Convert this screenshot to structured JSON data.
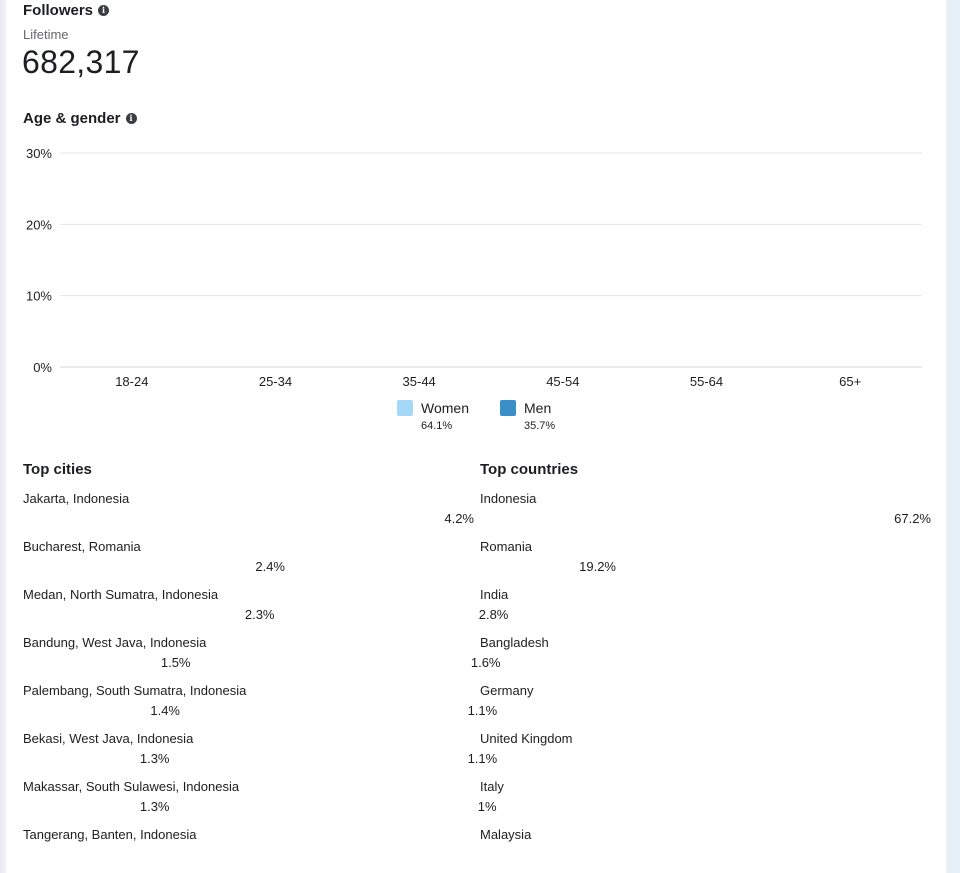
{
  "followers": {
    "title": "Followers",
    "period": "Lifetime",
    "total": "682,317",
    "title_icon": "info-icon"
  },
  "age_gender": {
    "title": "Age & gender",
    "title_icon": "info-icon"
  },
  "chart_data": {
    "type": "bar",
    "title": "",
    "categories": [
      "18-24",
      "25-34",
      "35-44",
      "45-54",
      "55-64",
      "65+"
    ],
    "series": [
      {
        "name": "Women",
        "values": [
          0,
          0,
          0,
          0,
          0,
          0
        ]
      },
      {
        "name": "Men",
        "values": [
          0,
          0,
          0,
          0,
          0,
          0
        ]
      }
    ],
    "y_ticks": [
      "0%",
      "10%",
      "20%",
      "30%"
    ],
    "ylim": [
      0,
      30
    ],
    "grid": true,
    "legend_position": "bottom"
  },
  "legend": [
    {
      "label": "Women",
      "value": "64.1%",
      "color": "#a5d8f6"
    },
    {
      "label": "Men",
      "value": "35.7%",
      "color": "#3b8fc9"
    }
  ],
  "top_cities": {
    "title": "Top cities",
    "items": [
      {
        "name": "Jakarta, Indonesia",
        "value": "4.2%",
        "share": 4.2
      },
      {
        "name": "Bucharest, Romania",
        "value": "2.4%",
        "share": 2.4
      },
      {
        "name": "Medan, North Sumatra, Indonesia",
        "value": "2.3%",
        "share": 2.3
      },
      {
        "name": "Bandung, West Java, Indonesia",
        "value": "1.5%",
        "share": 1.5
      },
      {
        "name": "Palembang, South Sumatra, Indonesia",
        "value": "1.4%",
        "share": 1.4
      },
      {
        "name": "Bekasi, West Java, Indonesia",
        "value": "1.3%",
        "share": 1.3
      },
      {
        "name": "Makassar, South Sulawesi, Indonesia",
        "value": "1.3%",
        "share": 1.3
      },
      {
        "name": "Tangerang, Banten, Indonesia",
        "value": "",
        "share": 0
      }
    ]
  },
  "top_countries": {
    "title": "Top countries",
    "items": [
      {
        "name": "Indonesia",
        "value": "67.2%",
        "share": 67.2
      },
      {
        "name": "Romania",
        "value": "19.2%",
        "share": 19.2
      },
      {
        "name": "India",
        "value": "2.8%",
        "share": 2.8
      },
      {
        "name": "Bangladesh",
        "value": "1.6%",
        "share": 1.6
      },
      {
        "name": "Germany",
        "value": "1.1%",
        "share": 1.1
      },
      {
        "name": "United Kingdom",
        "value": "1.1%",
        "share": 1.1
      },
      {
        "name": "Italy",
        "value": "1%",
        "share": 1.0
      },
      {
        "name": "Malaysia",
        "value": "",
        "share": 0
      }
    ]
  }
}
